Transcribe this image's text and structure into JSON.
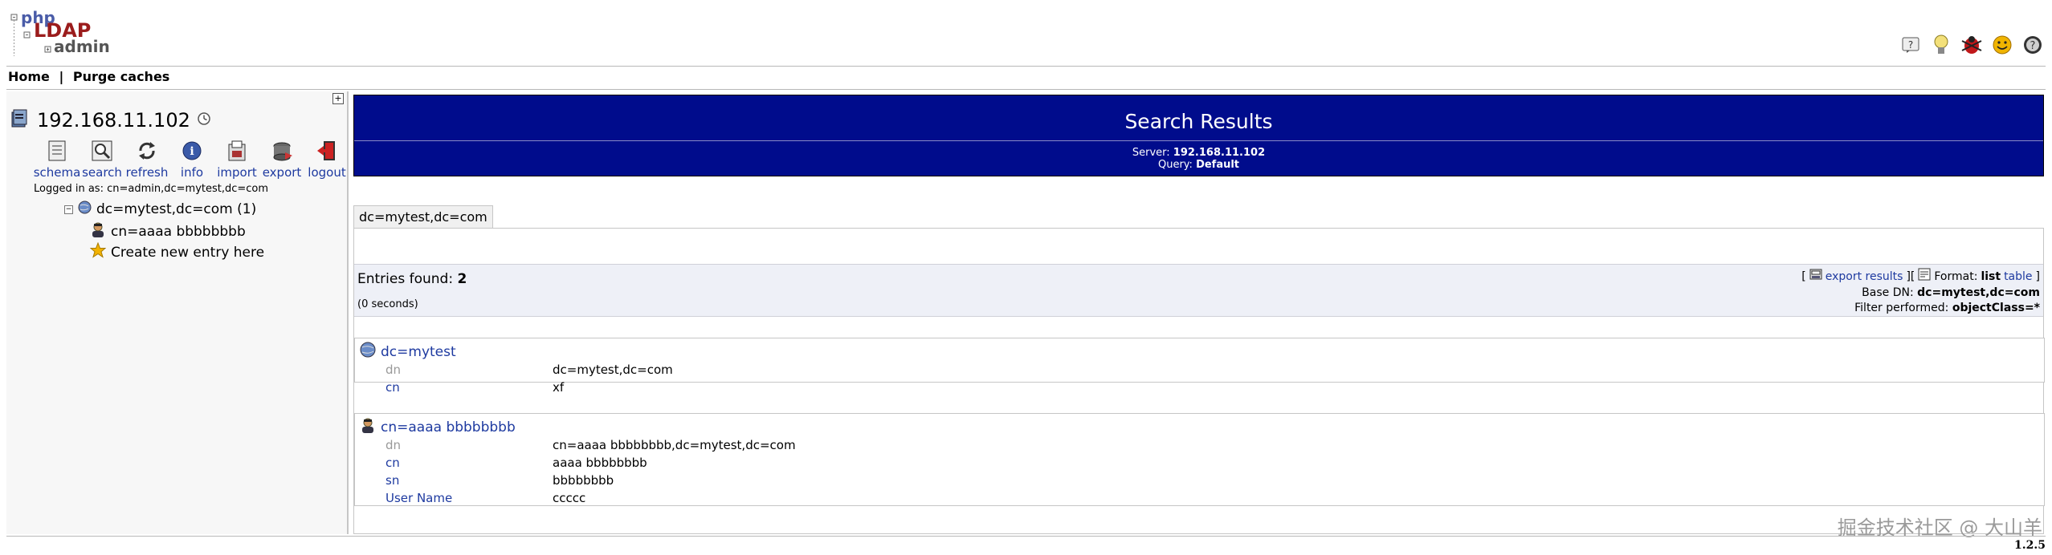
{
  "logo": {
    "line1": "php",
    "line2": "LDAP",
    "line3": "admin"
  },
  "header_icons": [
    "help-icon",
    "lightbulb-icon",
    "bug-icon",
    "smiley-icon",
    "donate-icon"
  ],
  "menu": {
    "home": "Home",
    "separator": "|",
    "purge": "Purge caches"
  },
  "tree": {
    "server": "192.168.11.102",
    "actions": [
      {
        "label": "schema",
        "icon": "schema-icon"
      },
      {
        "label": "search",
        "icon": "search-icon"
      },
      {
        "label": "refresh",
        "icon": "refresh-icon"
      },
      {
        "label": "info",
        "icon": "info-icon"
      },
      {
        "label": "import",
        "icon": "import-icon"
      },
      {
        "label": "export",
        "icon": "export-icon"
      },
      {
        "label": "logout",
        "icon": "logout-icon"
      }
    ],
    "logged_in": "Logged in as: cn=admin,dc=mytest,dc=com",
    "root_node": "dc=mytest,dc=com (1)",
    "child_node": "cn=aaaa bbbbbbbb",
    "create_node": "Create new entry here"
  },
  "banner": {
    "title": "Search Results",
    "server_label": "Server:",
    "server_value": "192.168.11.102",
    "query_label": "Query:",
    "query_value": "Default"
  },
  "base_tab": "dc=mytest,dc=com",
  "results": {
    "entries_label": "Entries found:",
    "entries_count": "2",
    "time": "(0 seconds)",
    "bracket_open": "[",
    "export_label": "export results",
    "bracket_mid": "][",
    "format_label": "Format:",
    "format_list": "list",
    "format_table": "table",
    "bracket_close": "]",
    "base_dn_label": "Base DN:",
    "base_dn_value": "dc=mytest,dc=com",
    "filter_label": "Filter performed:",
    "filter_value": "objectClass=*"
  },
  "entries": [
    {
      "title": "dc=mytest",
      "attrs": [
        {
          "name": "dn",
          "value": "dc=mytest,dc=com"
        },
        {
          "name": "cn",
          "value": "xf"
        }
      ]
    },
    {
      "title": "cn=aaaa bbbbbbbb",
      "attrs": [
        {
          "name": "dn",
          "value": "cn=aaaa bbbbbbbb,dc=mytest,dc=com"
        },
        {
          "name": "cn",
          "value": "aaaa bbbbbbbb"
        },
        {
          "name": "sn",
          "value": "bbbbbbbb"
        },
        {
          "name": "User Name",
          "value": "ccccc"
        }
      ]
    }
  ],
  "version": "1.2.5",
  "watermark": "掘金技术社区 @ 大山羊",
  "colors": {
    "banner": "#000c8c",
    "link": "#1e3aa0",
    "muted": "#999999"
  }
}
